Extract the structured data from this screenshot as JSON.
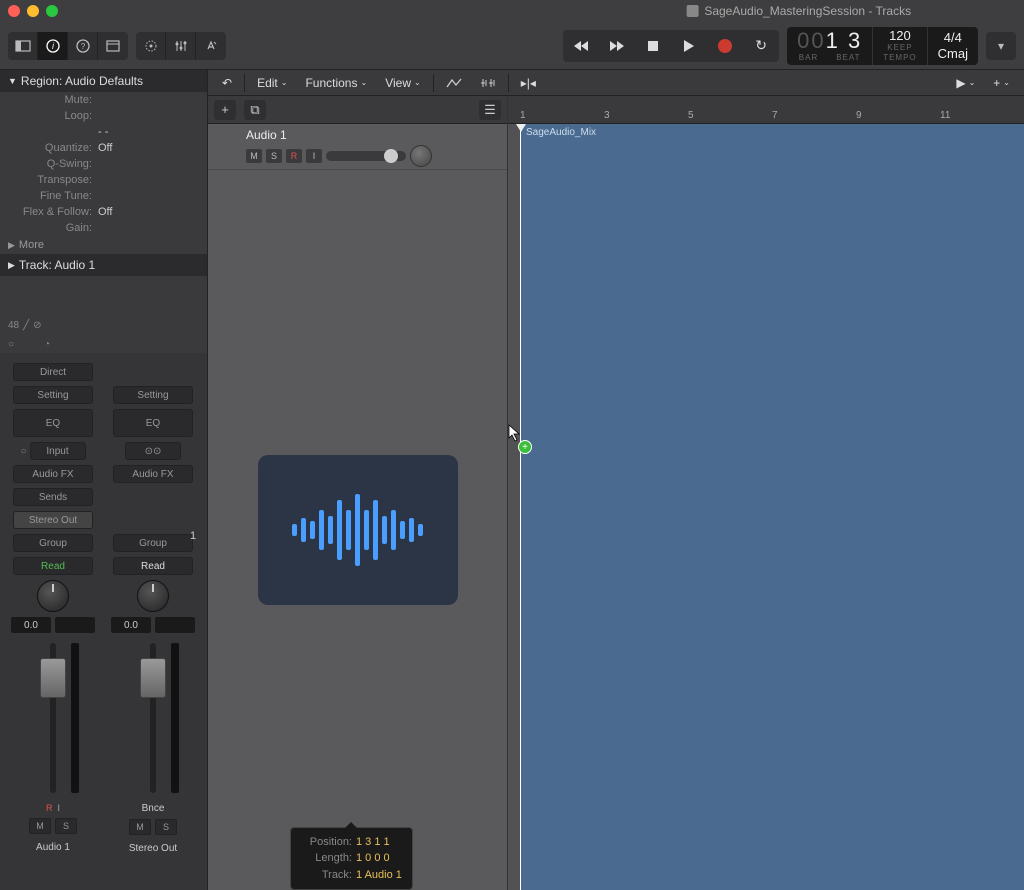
{
  "window": {
    "title": "SageAudio_MasteringSession - Tracks"
  },
  "lcd": {
    "bar_dim": "00",
    "bar": "1",
    "beat": "3",
    "bar_label": "BAR",
    "beat_label": "BEAT",
    "tempo": "120",
    "tempo_sub": "KEEP",
    "tempo_label": "TEMPO",
    "sig": "4/4",
    "key": "Cmaj"
  },
  "inspector": {
    "region_header": "Region: Audio Defaults",
    "rows": {
      "mute": "Mute:",
      "loop": "Loop:",
      "dashes": "- -",
      "quantize_l": "Quantize:",
      "quantize_v": "Off",
      "qswing": "Q-Swing:",
      "transpose": "Transpose:",
      "finetune": "Fine Tune:",
      "flex_l": "Flex & Follow:",
      "flex_v": "Off",
      "gain": "Gain:"
    },
    "more": "More",
    "track_header": "Track:  Audio 1",
    "midi_ch": "48"
  },
  "strip1": {
    "direct": "Direct",
    "setting": "Setting",
    "eq": "EQ",
    "input": "Input",
    "audiofx": "Audio FX",
    "sends": "Sends",
    "stereo": "Stereo Out",
    "group": "Group",
    "read": "Read",
    "db": "0.0",
    "rec_i": "R  I",
    "m": "M",
    "s": "S",
    "name": "Audio 1"
  },
  "strip2": {
    "setting": "Setting",
    "eq": "EQ",
    "stereo": "⊙⊙",
    "audiofx": "Audio FX",
    "group": "Group",
    "read": "Read",
    "db": "0.0",
    "bnce": "Bnce",
    "m": "M",
    "s": "S",
    "name": "Stereo Out"
  },
  "arrange_toolbar": {
    "edit": "Edit",
    "functions": "Functions",
    "view": "View"
  },
  "track": {
    "name": "Audio 1",
    "m": "M",
    "s": "S",
    "r": "R",
    "i": "I",
    "num": "1"
  },
  "ruler": {
    "m1": "1",
    "m3": "3",
    "m5": "5",
    "m7": "7",
    "m9": "9",
    "m11": "11"
  },
  "region": {
    "name": "SageAudio_Mix"
  },
  "tooltip": {
    "pos_l": "Position:",
    "pos_v": "1 3 1 1",
    "len_l": "Length:",
    "len_v": "1 0 0 0",
    "trk_l": "Track:",
    "trk_v": "1  Audio 1"
  }
}
